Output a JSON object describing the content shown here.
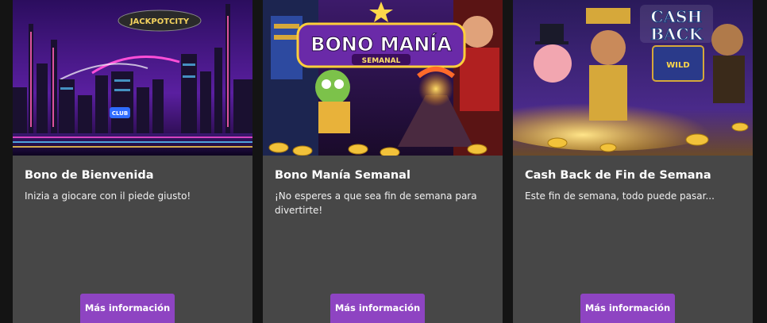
{
  "promotions": [
    {
      "title": "Bono de Bienvenida",
      "description": "Inizia a giocare con il piede giusto!",
      "button_label": "Más información",
      "banner": {
        "blimp_text": "JACKPOTCITY",
        "sign_text": "CLUB"
      }
    },
    {
      "title": "Bono Manía Semanal",
      "description": "¡No esperes a que sea fin de semana para divertirte!",
      "button_label": "Más información",
      "banner": {
        "logo_main": "BONO MANÍA",
        "logo_sub": "SEMANAL"
      }
    },
    {
      "title": "Cash Back de Fin de Semana",
      "description": "Este fin de semana, todo puede pasar...",
      "button_label": "Más información",
      "banner": {
        "logo_line1": "CASH",
        "logo_line2": "BACK",
        "reel_text": "WILD"
      }
    }
  ],
  "colors": {
    "page_background": "#141414",
    "card_background": "#474747",
    "button_background": "#8e44c2",
    "text": "#ffffff"
  }
}
